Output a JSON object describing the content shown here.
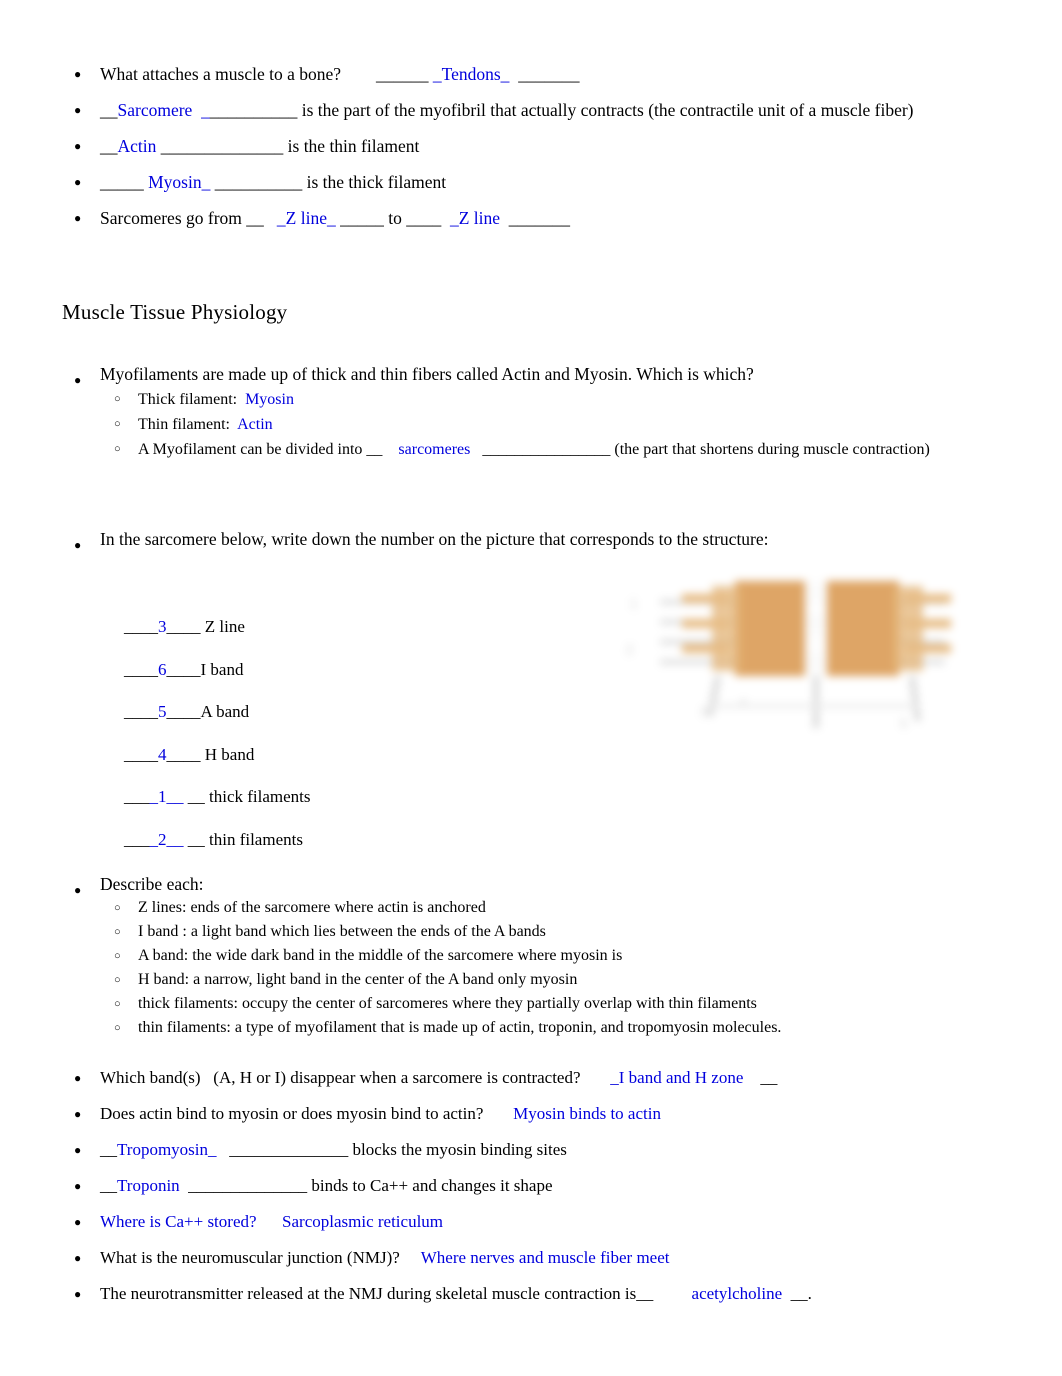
{
  "colors": {
    "answer_blue": "#0000dd",
    "text_black": "#000000",
    "figure_orange": "#dda котор"
  },
  "top_questions": [
    {
      "id": "tendons",
      "parts": [
        {
          "text": "What attaches a muscle to a bone?",
          "color": "black"
        },
        {
          "text": "        ______ ",
          "color": "black"
        },
        {
          "text": "_Tendons_",
          "color": "blue"
        },
        {
          "text": "  _______",
          "color": "black"
        }
      ]
    },
    {
      "id": "sarcomere",
      "parts": [
        {
          "text": "__",
          "color": "black"
        },
        {
          "text": "Sarcomere",
          "color": "blue"
        },
        {
          "text": "  _",
          "color": "blue"
        },
        {
          "text": "__________",
          "color": "black"
        },
        {
          "text": " is the part of the myofibril that actually contracts (the contractile unit of a muscle fiber)",
          "color": "black"
        }
      ]
    },
    {
      "id": "actin",
      "parts": [
        {
          "text": "__",
          "color": "black"
        },
        {
          "text": "Actin",
          "color": "blue"
        },
        {
          "text": " ______________",
          "color": "black"
        },
        {
          "text": " is the thin filament",
          "color": "black"
        }
      ]
    },
    {
      "id": "myosin",
      "parts": [
        {
          "text": "_____ ",
          "color": "black"
        },
        {
          "text": "Myosin_",
          "color": "blue"
        },
        {
          "text": " __________",
          "color": "black"
        },
        {
          "text": " is the thick filament",
          "color": "black"
        }
      ]
    },
    {
      "id": "zline",
      "parts": [
        {
          "text": "Sarcomeres go from __",
          "color": "black"
        },
        {
          "text": "   _Z line_",
          "color": "blue"
        },
        {
          "text": " _____ to ____",
          "color": "black"
        },
        {
          "text": "  _Z line",
          "color": "blue"
        },
        {
          "text": "  _______",
          "color": "black"
        }
      ]
    }
  ],
  "heading": "Muscle Tissue Physiology",
  "myofilament": {
    "prompt": "Myofilaments are made up of thick and thin fibers called Actin and Myosin. Which is which?",
    "sub": [
      {
        "id": "thick-filament",
        "parts": [
          {
            "text": "Thick filament:  ",
            "color": "black"
          },
          {
            "text": "Myosin",
            "color": "blue"
          }
        ]
      },
      {
        "id": "thin-filament",
        "parts": [
          {
            "text": "Thin filament:  ",
            "color": "black"
          },
          {
            "text": "Actin",
            "color": "blue"
          }
        ]
      },
      {
        "id": "divided-into",
        "parts": [
          {
            "text": "A Myofilament can be divided into __",
            "color": "black"
          },
          {
            "text": "    sarcomeres",
            "color": "blue"
          },
          {
            "text": "   ________________ (the part that shortens during muscle contraction)",
            "color": "black"
          }
        ]
      }
    ]
  },
  "instruction": "In the sarcomere below, write down the number on the picture that corresponds to the structure:",
  "blank_rows": [
    {
      "pre": "____",
      "answer": "3",
      "mid": "____",
      "label": " Z line",
      "answer_underscores": false
    },
    {
      "pre": "____",
      "answer": "6",
      "mid": "____",
      "label": "I band",
      "answer_underscores": false
    },
    {
      "pre": "____",
      "answer": "5",
      "mid": "____",
      "label": "A band",
      "answer_underscores": false
    },
    {
      "pre": "____",
      "answer": "4",
      "mid": "____",
      "label": " H band",
      "answer_underscores": false
    },
    {
      "pre": "___",
      "answer": "_1__",
      "mid": " __",
      "label": " thick filaments",
      "answer_underscores": true
    },
    {
      "pre": "___",
      "answer": "_2__",
      "mid": " __",
      "label": " thin filaments",
      "answer_underscores": true
    }
  ],
  "describe": {
    "prompt": "Describe each:",
    "items": [
      "Z lines:   ends of the sarcomere where actin is anchored",
      "I band : a light band which lies between the ends of the A bands",
      "A band: the wide dark band in the middle of the sarcomere where myosin is",
      "H band: a narrow, light band in the center of the A band only myosin",
      "thick filaments: occupy the center of sarcomeres where they partially overlap with thin filaments",
      "thin filaments: a type of myofilament that is made up of actin, troponin, and tropomyosin molecules."
    ]
  },
  "tail_questions": [
    {
      "id": "which-band-disappears",
      "parts": [
        {
          "text": "Which band(s)   (A, H or I) disappear when a sarcomere is contracted?",
          "color": "black"
        },
        {
          "text": "       _I band and H zone",
          "color": "blue"
        },
        {
          "text": "    __",
          "color": "black"
        }
      ]
    },
    {
      "id": "actin-myosin-binding",
      "parts": [
        {
          "text": "Does actin bind to myosin or does myosin bind to actin?",
          "color": "black"
        },
        {
          "text": "       Myosin binds to actin",
          "color": "blue"
        }
      ]
    },
    {
      "id": "tropomyosin",
      "parts": [
        {
          "text": "__",
          "color": "black"
        },
        {
          "text": "Tropomyosin_",
          "color": "blue"
        },
        {
          "text": "   ______________ blocks the myosin binding sites",
          "color": "black"
        }
      ]
    },
    {
      "id": "troponin",
      "parts": [
        {
          "text": "__",
          "color": "black"
        },
        {
          "text": "Troponin",
          "color": "blue"
        },
        {
          "text": "  ______________ binds to Ca++ and changes it shape",
          "color": "black"
        }
      ]
    },
    {
      "id": "ca-stored",
      "parts": [
        {
          "text": "Where is Ca++ stored?",
          "color": "blue"
        },
        {
          "text": "      Sarcoplasmic reticulum",
          "color": "blue"
        }
      ]
    },
    {
      "id": "nmj",
      "parts": [
        {
          "text": "What is the neuromuscular junction (NMJ)?",
          "color": "black"
        },
        {
          "text": "     Where nerves and muscle fiber meet",
          "color": "blue"
        }
      ]
    },
    {
      "id": "neurotransmitter",
      "parts": [
        {
          "text": "The neurotransmitter released at the NMJ during skeletal muscle contraction is__",
          "color": "black"
        },
        {
          "text": "         acetylcholine",
          "color": "blue"
        },
        {
          "text": "  __.",
          "color": "black"
        }
      ]
    }
  ],
  "figure": {
    "name": "sarcomere-diagram",
    "description": "Blurred sarcomere diagram with orange thick-filament blocks, pale thin filaments and numeric labels",
    "orange": "#dda15e",
    "pale": "#e8e8e8"
  }
}
